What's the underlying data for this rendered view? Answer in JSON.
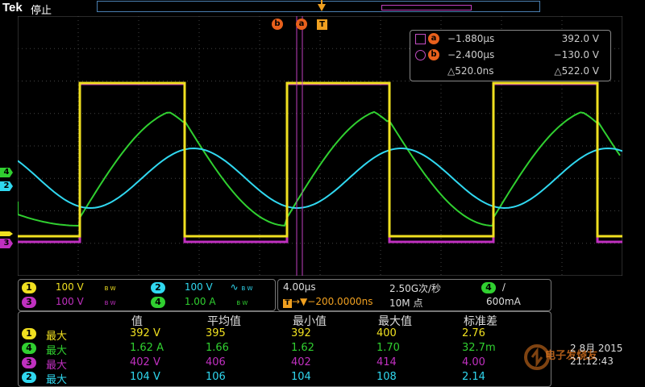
{
  "header": {
    "brand": "Tek",
    "run_state": "停止"
  },
  "markers": {
    "a": "a",
    "b": "b",
    "t": "T"
  },
  "cursor_readout": {
    "a": {
      "badge": "a",
      "time": "−1.880μs",
      "value": "392.0 V"
    },
    "b": {
      "badge": "b",
      "time": "−2.400μs",
      "value": "−130.0 V"
    },
    "delta": {
      "time": "△520.0ns",
      "value": "△522.0 V"
    }
  },
  "channels": [
    {
      "num": "1",
      "scale": "100 V",
      "bw": "B W",
      "color": "#f0e020"
    },
    {
      "num": "2",
      "scale": "100 V",
      "bw": "B W",
      "color": "#30d8f0"
    },
    {
      "num": "3",
      "scale": "100 V",
      "bw": "B W",
      "color": "#c030c0"
    },
    {
      "num": "4",
      "scale": "1.00 A",
      "bw": "B W",
      "color": "#30d030"
    }
  ],
  "horizontal": {
    "time_div": "4.00μs",
    "sample_rate": "2.50G次/秒",
    "trigger_pos": "→▼−200.0000ns",
    "record": "10M 点",
    "trig_source": "4",
    "trig_slope": "∕",
    "trig_level": "600mA"
  },
  "measurements": {
    "headers": [
      "值",
      "平均值",
      "最小值",
      "最大值",
      "标准差"
    ],
    "rows": [
      {
        "ch": "1",
        "label": "最大",
        "color": "#f0e020",
        "values": [
          "392 V",
          "395",
          "392",
          "400",
          "2.76"
        ]
      },
      {
        "ch": "4",
        "label": "最大",
        "color": "#30d030",
        "values": [
          "1.62 A",
          "1.66",
          "1.62",
          "1.70",
          "32.7m"
        ]
      },
      {
        "ch": "3",
        "label": "最大",
        "color": "#c030c0",
        "values": [
          "402 V",
          "406",
          "402",
          "414",
          "4.00"
        ]
      },
      {
        "ch": "2",
        "label": "最大",
        "color": "#30d8f0",
        "values": [
          "104 V",
          "106",
          "104",
          "108",
          "2.14"
        ]
      }
    ]
  },
  "clock": {
    "date": "2 8月 2015",
    "time": "21:12:43"
  },
  "watermark": "电子发烧友",
  "colors": {
    "ch1": "#f0e020",
    "ch2": "#30d8f0",
    "ch3": "#c030c0",
    "ch4": "#30d030",
    "cursor": "#c040c0",
    "marker": "#e8601c"
  }
}
